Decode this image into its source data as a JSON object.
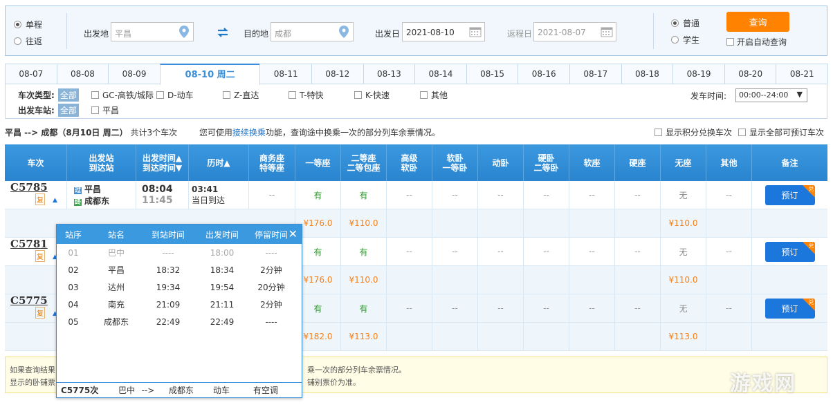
{
  "search": {
    "trip_one_way": "单程",
    "trip_round": "往返",
    "from_label": "出发地",
    "from_value": "平昌",
    "to_label": "目的地",
    "to_value": "成都",
    "depart_label": "出发日",
    "depart_value": "2021-08-10",
    "return_label": "返程日",
    "return_value": "2021-08-07",
    "type_normal": "普通",
    "type_student": "学生",
    "query_button": "查询",
    "auto_query": "开启自动查询"
  },
  "dates": [
    "08-07",
    "08-08",
    "08-09",
    "08-10 周二",
    "08-11",
    "08-12",
    "08-13",
    "08-14",
    "08-15",
    "08-16",
    "08-17",
    "08-18",
    "08-19",
    "08-20",
    "08-21"
  ],
  "filter": {
    "type_label": "车次类型:",
    "all": "全部",
    "types": [
      "GC-高铁/城际",
      "D-动车",
      "Z-直达",
      "T-特快",
      "K-快速",
      "其他"
    ],
    "station_label": "出发车站:",
    "station_option": "平昌",
    "time_label": "发车时间:",
    "time_value": "00:00--24:00"
  },
  "summary": {
    "route": "平昌 --> 成都（8月10日 周二）",
    "count": "共计3个车次",
    "pre": "您可使用",
    "link": "接续换乘",
    "post": "功能，查询途中换乘一次的部分列车余票情况。",
    "opt_points": "显示积分兑换车次",
    "opt_bookable": "显示全部可预订车次"
  },
  "headers": {
    "train": "车次",
    "stations1": "出发站",
    "stations2": "到达站",
    "times1": "出发时间▲",
    "times2": "到达时间▼",
    "duration": "历时▲",
    "business1": "商务座",
    "business2": "特等座",
    "first": "一等座",
    "second1": "二等座",
    "second2": "二等包座",
    "hsoft1": "高级",
    "hsoft2": "软卧",
    "softsl1": "软卧",
    "softsl2": "一等卧",
    "dongwo": "动卧",
    "hardsl1": "硬卧",
    "hardsl2": "二等卧",
    "softseat": "软座",
    "hardseat": "硬座",
    "noseat": "无座",
    "other": "其他",
    "remark": "备注"
  },
  "trains": [
    {
      "no": "C5785",
      "from": "平昌",
      "to": "成都东",
      "dep": "08:04",
      "arr": "11:45",
      "dur": "03:41",
      "dur_note": "当日到达",
      "seats": [
        "--",
        "有",
        "有",
        "--",
        "--",
        "--",
        "--",
        "--",
        "--",
        "无",
        "--"
      ],
      "first_price": "¥176.0",
      "second_price": "¥110.0",
      "noseat_price": "¥110.0",
      "book": "预订",
      "badge": "兑",
      "flag": "复",
      "from_tag": "过",
      "to_tag": "终"
    },
    {
      "no": "C5781",
      "seats": [
        "有",
        "有",
        "--",
        "--",
        "--",
        "--",
        "--",
        "--",
        "无",
        "--"
      ],
      "first_price": "¥176.0",
      "second_price": "¥110.0",
      "noseat_price": "¥110.0",
      "book": "预订",
      "badge": "兑",
      "flag": "复"
    },
    {
      "no": "C5775",
      "seats": [
        "有",
        "有",
        "--",
        "--",
        "--",
        "--",
        "--",
        "--",
        "无",
        "--"
      ],
      "first_price": "¥182.0",
      "second_price": "¥113.0",
      "noseat_price": "¥113.0",
      "book": "预订",
      "badge": "兑",
      "flag": "复"
    }
  ],
  "notice": {
    "line1a": "如果查询结果",
    "line1b": "乘一次的部分列车余票情况。",
    "line2a": "显示的卧铺票",
    "line2b": "铺别票价为准。"
  },
  "popup": {
    "headers": [
      "站序",
      "站名",
      "到站时间",
      "出发时间",
      "停留时间"
    ],
    "close": "✕",
    "rows": [
      [
        "01",
        "巴中",
        "----",
        "18:00",
        "----"
      ],
      [
        "02",
        "平昌",
        "18:32",
        "18:34",
        "2分钟"
      ],
      [
        "03",
        "达州",
        "19:34",
        "19:54",
        "20分钟"
      ],
      [
        "04",
        "南充",
        "21:09",
        "21:11",
        "2分钟"
      ],
      [
        "05",
        "成都东",
        "22:49",
        "22:49",
        "----"
      ]
    ],
    "footer": {
      "train": "C5775次",
      "from": "巴中",
      "arrow": "-->",
      "to": "成都东",
      "type": "动车",
      "ac": "有空调"
    }
  },
  "watermark": "游戏网"
}
